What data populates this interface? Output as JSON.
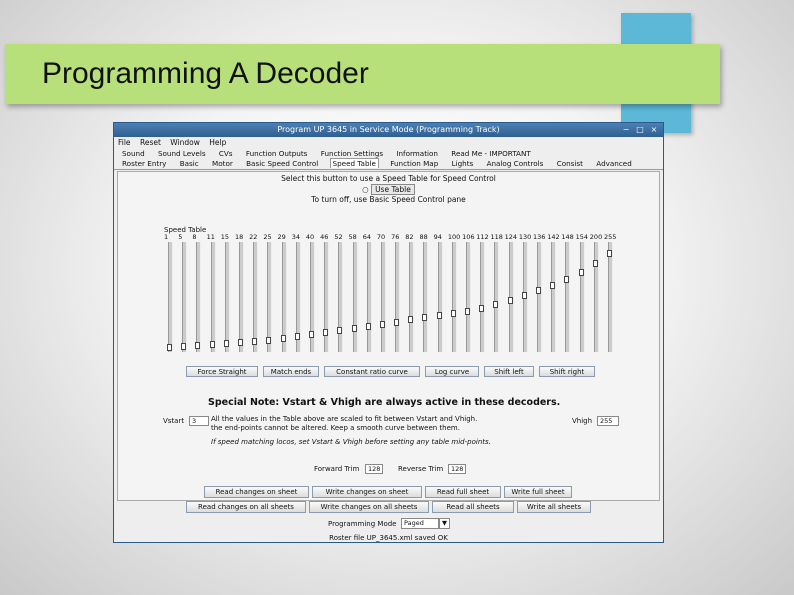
{
  "slide": {
    "title": "Programming A Decoder"
  },
  "window": {
    "title": "Program UP 3645 in Service Mode (Programming Track)",
    "controls": [
      "−",
      "□",
      "×"
    ]
  },
  "menu": [
    "File",
    "Reset",
    "Window",
    "Help"
  ],
  "tabs_row1": [
    "Sound",
    "Sound Levels",
    "CVs",
    "Function Outputs",
    "Function Settings",
    "Information",
    "Read Me - IMPORTANT"
  ],
  "tabs_row2": [
    "Roster Entry",
    "Basic",
    "Motor",
    "Basic Speed Control",
    "Speed Table",
    "Function Map",
    "Lights",
    "Analog Controls",
    "Consist",
    "Advanced"
  ],
  "active_tab": "Speed Table",
  "speed_table": {
    "instruction": "Select this button to use a Speed Table for Speed Control",
    "use_table_label": "Use Table",
    "turn_off_text": "To turn off, use Basic Speed Control pane",
    "label": "Speed Table",
    "steps": [
      "1",
      "5",
      "8",
      "11",
      "15",
      "18",
      "22",
      "25",
      "29",
      "34",
      "40",
      "46",
      "52",
      "58",
      "64",
      "70",
      "76",
      "82",
      "88",
      "94",
      "100",
      "106",
      "112",
      "118",
      "124",
      "130",
      "136",
      "142",
      "148",
      "154",
      "200",
      "255"
    ],
    "levels": [
      0.0,
      0.01,
      0.02,
      0.03,
      0.04,
      0.05,
      0.06,
      0.07,
      0.09,
      0.11,
      0.13,
      0.15,
      0.17,
      0.19,
      0.21,
      0.23,
      0.25,
      0.27,
      0.29,
      0.31,
      0.33,
      0.35,
      0.38,
      0.42,
      0.46,
      0.51,
      0.56,
      0.61,
      0.67,
      0.74,
      0.82,
      0.92
    ]
  },
  "curve_buttons": [
    "Force Straight",
    "Match ends",
    "Constant ratio curve",
    "Log curve",
    "Shift left",
    "Shift right"
  ],
  "special_note": {
    "heading": "Special Note: Vstart & Vhigh are always active in these decoders.",
    "line1": "All the values in the Table above are scaled to fit between Vstart and Vhigh.",
    "line2": "the end-points cannot be altered. Keep a smooth curve between them.",
    "line3": "If speed matching locos, set Vstart & Vhigh before setting any table mid-points."
  },
  "vstart": {
    "label": "Vstart",
    "value": "3"
  },
  "vhigh": {
    "label": "Vhigh",
    "value": "255"
  },
  "trim": {
    "forward_label": "Forward Trim",
    "forward_value": "128",
    "reverse_label": "Reverse Trim",
    "reverse_value": "128"
  },
  "sheet_buttons": [
    "Read changes on sheet",
    "Write changes on sheet",
    "Read full sheet",
    "Write full sheet"
  ],
  "all_buttons": [
    "Read changes on all sheets",
    "Write changes on all sheets",
    "Read all sheets",
    "Write all sheets"
  ],
  "programming_mode": {
    "label": "Programming Mode",
    "value": "Paged"
  },
  "status": "Roster file UP_3645.xml saved OK"
}
